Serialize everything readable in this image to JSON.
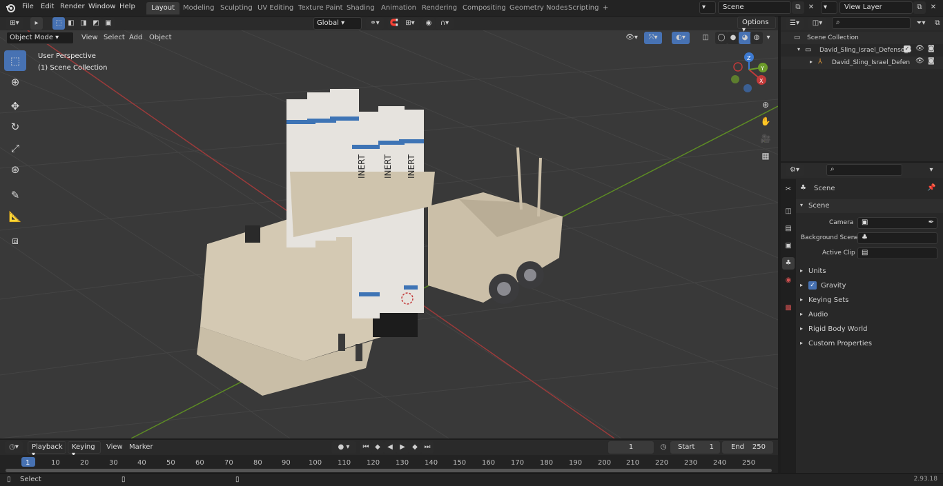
{
  "menu": {
    "file": "File",
    "edit": "Edit",
    "render": "Render",
    "window": "Window",
    "help": "Help"
  },
  "workspaces": [
    "Layout",
    "Modeling",
    "Sculpting",
    "UV Editing",
    "Texture Paint",
    "Shading",
    "Animation",
    "Rendering",
    "Compositing",
    "Geometry Nodes",
    "Scripting"
  ],
  "scene_field": "Scene",
  "view_layer_field": "View Layer",
  "viewport_header": {
    "mode": "Object Mode",
    "view": "View",
    "select": "Select",
    "add": "Add",
    "object": "Object",
    "transform": "Global",
    "options": "Options"
  },
  "viewport": {
    "perspective": "User Perspective",
    "collection": "(1) Scene Collection",
    "model_text": "INERT",
    "axis_x": "X",
    "axis_y": "Y",
    "axis_z": "Z"
  },
  "outliner": {
    "root": "Scene Collection",
    "item1": "David_Sling_Israel_Defense_S",
    "item2": "David_Sling_Israel_Defen"
  },
  "properties": {
    "context": "Scene",
    "section": "Scene",
    "camera_label": "Camera",
    "bg_scene_label": "Background Scene",
    "active_clip_label": "Active Clip",
    "subsections": [
      "Units",
      "Gravity",
      "Keying Sets",
      "Audio",
      "Rigid Body World",
      "Custom Properties"
    ]
  },
  "timeline": {
    "playback": "Playback",
    "keying": "Keying",
    "view": "View",
    "marker": "Marker",
    "current_frame": "1",
    "start_label": "Start",
    "start_value": "1",
    "end_label": "End",
    "end_value": "250",
    "ruler": [
      "1",
      "10",
      "20",
      "30",
      "40",
      "50",
      "60",
      "70",
      "80",
      "90",
      "100",
      "110",
      "120",
      "130",
      "140",
      "150",
      "160",
      "170",
      "180",
      "190",
      "200",
      "210",
      "220",
      "230",
      "240",
      "250"
    ]
  },
  "status": {
    "select": "Select",
    "version": "2.93.18"
  },
  "colors": {
    "accent": "#4772b3",
    "x_axis": "#c33a3a",
    "y_axis": "#6c9b2a",
    "z_axis": "#3d7ad1"
  },
  "icons": [
    "blender-logo-icon",
    "select-box-icon",
    "cursor-icon",
    "move-icon",
    "rotate-icon",
    "scale-icon",
    "transform-icon",
    "annotate-icon",
    "measure-icon",
    "add-cube-icon",
    "zoom-icon",
    "hand-icon",
    "camera-icon",
    "grid-icon",
    "eye-icon",
    "camera-render-icon",
    "search-icon",
    "filter-icon",
    "pin-icon",
    "play-icon"
  ]
}
